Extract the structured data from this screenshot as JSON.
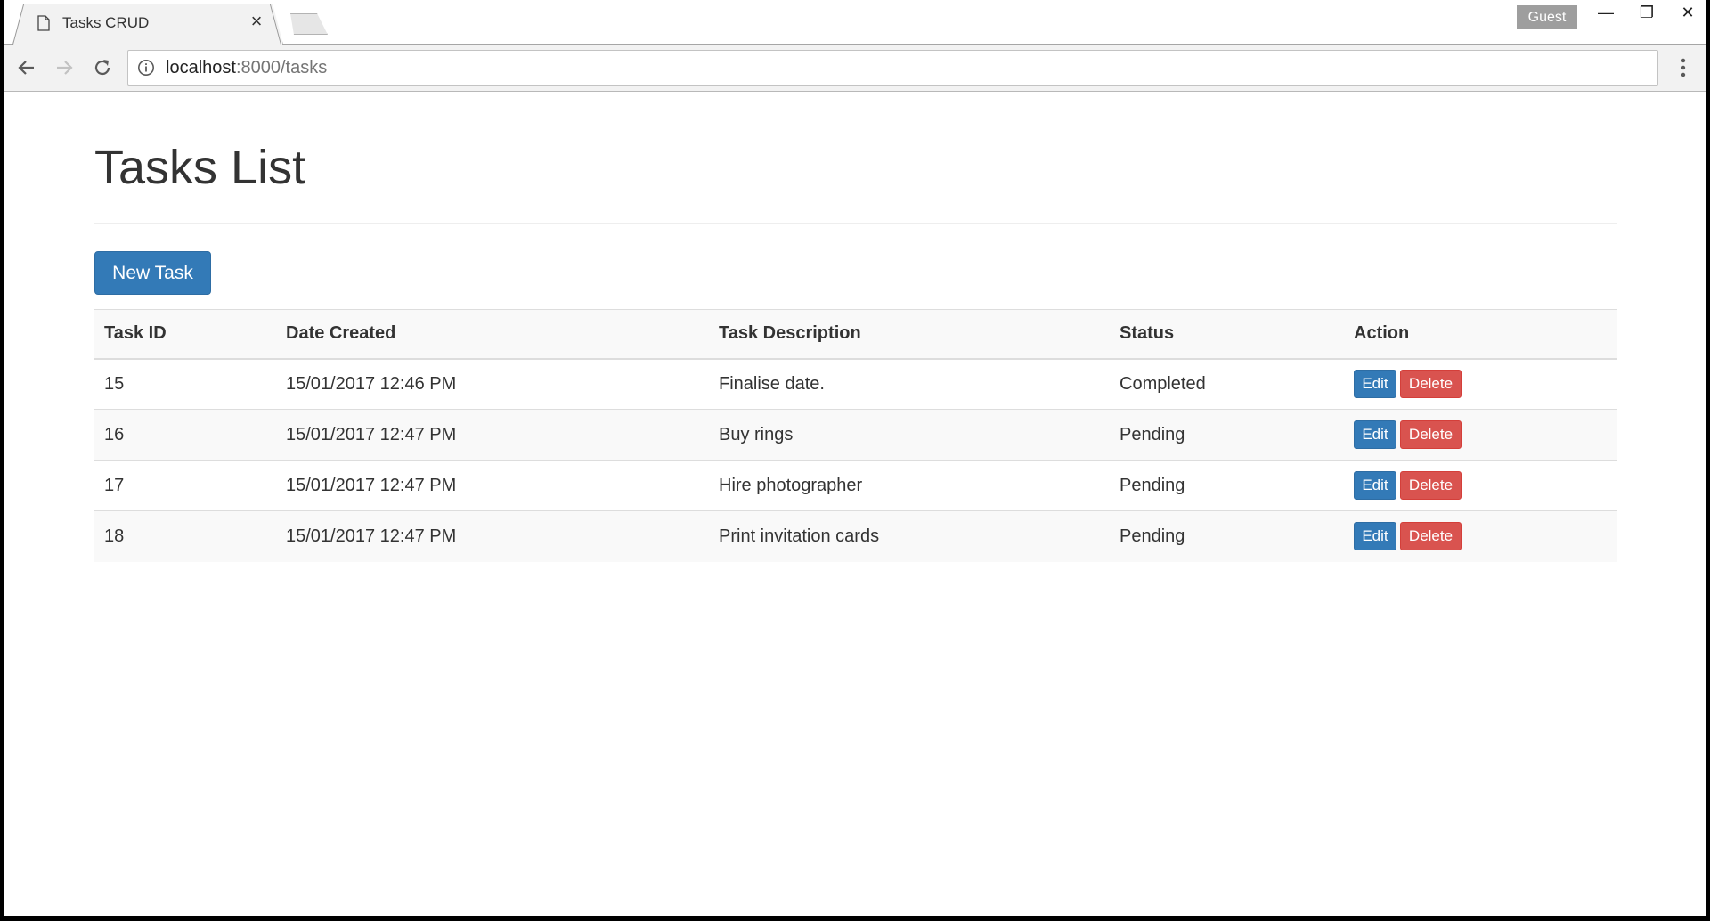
{
  "browser": {
    "tab_title": "Tasks CRUD",
    "tab_close": "×",
    "profile": "Guest",
    "url_host": "localhost",
    "url_path": ":8000/tasks",
    "icons": {
      "tab": "page-icon",
      "back": "back-arrow-icon",
      "forward": "forward-arrow-icon",
      "reload": "reload-icon",
      "info": "info-icon",
      "menu": "kebab-menu-icon"
    }
  },
  "window_controls": {
    "minimize": "—",
    "restore": "❐",
    "close": "✕"
  },
  "page": {
    "title": "Tasks List",
    "new_button": "New Task",
    "columns": [
      "Task ID",
      "Date Created",
      "Task Description",
      "Status",
      "Action"
    ],
    "edit_label": "Edit",
    "delete_label": "Delete",
    "rows": [
      {
        "id": "15",
        "date": "15/01/2017 12:46 PM",
        "description": "Finalise date.",
        "status": "Completed"
      },
      {
        "id": "16",
        "date": "15/01/2017 12:47 PM",
        "description": "Buy rings",
        "status": "Pending"
      },
      {
        "id": "17",
        "date": "15/01/2017 12:47 PM",
        "description": "Hire photographer",
        "status": "Pending"
      },
      {
        "id": "18",
        "date": "15/01/2017 12:47 PM",
        "description": "Print invitation cards",
        "status": "Pending"
      }
    ]
  },
  "colors": {
    "primary": "#337ab7",
    "danger": "#d9534f",
    "stripe": "#f9f9f9",
    "text": "#333333"
  }
}
